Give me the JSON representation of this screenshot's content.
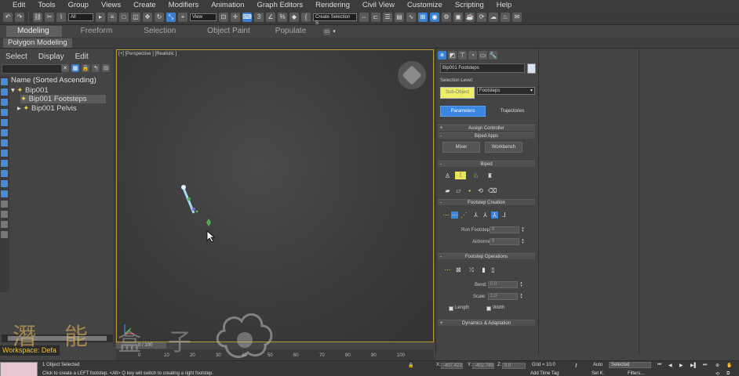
{
  "menu": [
    "Edit",
    "Tools",
    "Group",
    "Views",
    "Create",
    "Modifiers",
    "Animation",
    "Graph Editors",
    "Rendering",
    "Civil View",
    "Customize",
    "Scripting",
    "Help"
  ],
  "toolbar": {
    "filter_value": "All",
    "refcoord_value": "View",
    "selset_value": "Create Selection S"
  },
  "ribbon": {
    "tabs": [
      "Modeling",
      "Freeform",
      "Selection",
      "Object Paint",
      "Populate"
    ],
    "subtab": "Polygon Modeling"
  },
  "explorer": {
    "menu": [
      "Select",
      "Display",
      "Edit"
    ],
    "header": "Name (Sorted Ascending)",
    "items": [
      "Bip001",
      "Bip001 Footsteps",
      "Bip001 Pelvis"
    ],
    "workspace": "Workspace: Defa"
  },
  "viewport": {
    "label": "[+] [Perspective ] [Realistic ]"
  },
  "timeline": {
    "slider_label": "0 / 100",
    "ticks": [
      "0",
      "10",
      "20",
      "30",
      "40",
      "50",
      "60",
      "70",
      "80",
      "90",
      "100"
    ]
  },
  "panel": {
    "object_name": "Bip001 Footsteps",
    "selection_level_label": "Selection Level:",
    "sub_object": "Sub-Object",
    "footsteps_option": "Footsteps",
    "tab_parameters": "Parameters",
    "tab_trajectories": "Trajectories",
    "assign_controller": "Assign Controller",
    "biped_apps": "Biped Apps",
    "mixer": "Mixer",
    "workbench": "Workbench",
    "biped": "Biped",
    "footstep_creation": "Footstep Creation",
    "run_footstep": "Run Footstep:",
    "run_footstep_value": "8",
    "airborne": "Airborne:",
    "airborne_value": "8",
    "footstep_operations": "Footstep Operations",
    "bend": "Bend:",
    "bend_value": "0.0",
    "scale": "Scale:",
    "scale_value": "1.0",
    "length": "Length",
    "width": "Width",
    "dynamics": "Dynamics & Adaptation"
  },
  "status": {
    "selected": "1 Object Selected",
    "prompt": "Click to create a LEFT footstep. <Alt> Q key will switch to creating a right footstep.",
    "x_value": "-407.423",
    "y_value": "-402.789",
    "z_value": "0.0",
    "grid": "Grid = 10.0",
    "auto": "Auto",
    "selected_dd": "Selected",
    "setk": "Set K.",
    "filters": "Filters...",
    "add_time_tag": "Add Time Tag"
  },
  "watermark": {
    "chars": [
      "潛",
      "能",
      "盒",
      "子"
    ]
  }
}
